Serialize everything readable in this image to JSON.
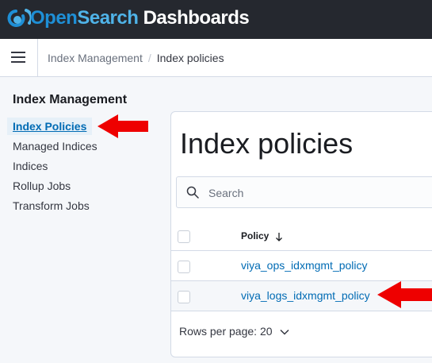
{
  "topbar": {
    "brand_open": "Open",
    "brand_search": "Search",
    "brand_dashboards": " Dashboards"
  },
  "breadcrumbs": {
    "parent": "Index Management",
    "separator": "/",
    "current": "Index policies"
  },
  "sidebar": {
    "title": "Index Management",
    "items": [
      {
        "label": "Index Policies",
        "selected": true
      },
      {
        "label": "Managed Indices"
      },
      {
        "label": "Indices"
      },
      {
        "label": "Rollup Jobs"
      },
      {
        "label": "Transform Jobs"
      }
    ]
  },
  "main": {
    "title": "Index policies",
    "search": {
      "placeholder": "Search",
      "value": ""
    },
    "table": {
      "column_header": "Policy",
      "sort": "descending",
      "rows": [
        {
          "policy": "viya_ops_idxmgmt_policy"
        },
        {
          "policy": "viya_logs_idxmgmt_policy"
        }
      ]
    },
    "pagination": {
      "label": "Rows per page: 20"
    }
  },
  "annotations": {
    "arrow_color": "#ee0000",
    "targets": [
      "Index Policies",
      "viya_logs_idxmgmt_policy"
    ]
  },
  "colors": {
    "topbar": "#25282f",
    "link": "#006bb4",
    "selected_bg": "#e6f0f8"
  },
  "icons": [
    "opensearch-logo-icon",
    "menu-icon",
    "search-icon",
    "sort-arrow-down-icon",
    "chevron-down-icon",
    "red-arrow-icon"
  ]
}
